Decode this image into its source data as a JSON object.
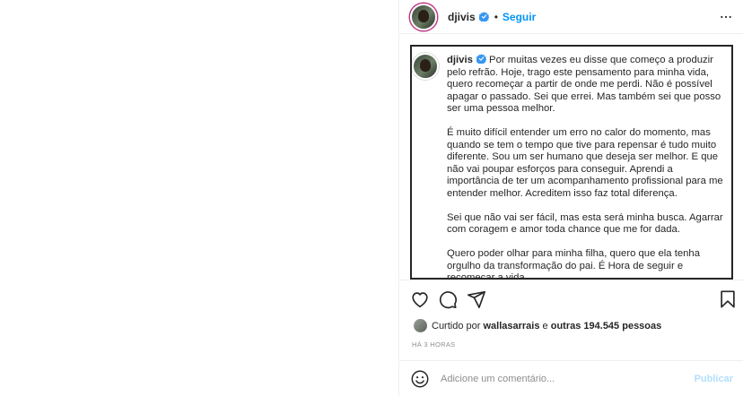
{
  "header": {
    "username": "djivis",
    "separator": "•",
    "follow_label": "Seguir",
    "more_icon": "more-horizontal-icon",
    "verified_color": "#3897f0",
    "follow_color": "#0095f6"
  },
  "caption": {
    "username": "djivis",
    "paragraphs": [
      "Por muitas vezes eu disse que começo a produzir pelo refrão. Hoje, trago este pensamento para minha vida, quero recomeçar a partir de onde me perdi. Não é possível apagar o passado. Sei que errei. Mas também sei que posso ser uma pessoa melhor.",
      "É muito difícil entender um erro no calor do momento, mas quando se tem o tempo que tive para repensar é tudo muito diferente. Sou um ser humano que deseja ser melhor. E que não vai poupar esforços para conseguir. Aprendi a importância de ter um acompanhamento profissional para me entender melhor. Acreditem isso faz total diferença.",
      "Sei que não vai ser fácil, mas esta será minha busca. Agarrar com coragem e amor toda chance que me for dada.",
      "Quero poder olhar para minha filha, quero que ela tenha orgulho da transformação do pai. É Hora de seguir e recomeçar a vida"
    ]
  },
  "actions": {
    "like_icon": "heart-icon",
    "comment_icon": "comment-icon",
    "share_icon": "send-icon",
    "save_icon": "bookmark-icon"
  },
  "likes": {
    "prefix": "Curtido por",
    "user": "wallasarrais",
    "middle": "e",
    "others": "outras 194.545 pessoas"
  },
  "time": "HÁ 3 HORAS",
  "comment": {
    "placeholder": "Adicione um comentário...",
    "publish_label": "Publicar",
    "emoji_icon": "emoji-icon",
    "publish_color": "#b2dffc"
  }
}
